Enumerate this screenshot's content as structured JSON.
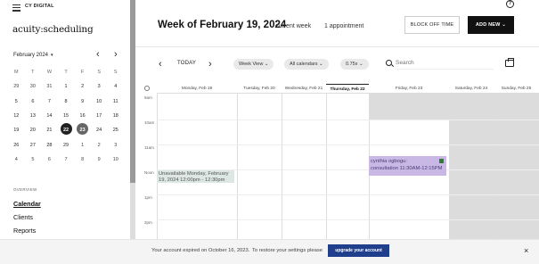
{
  "sidebar": {
    "brand": "CY DIGITAL",
    "logo": "acuity:scheduling",
    "month_label": "February 2024",
    "days_of_week": [
      "M",
      "T",
      "W",
      "T",
      "F",
      "S",
      "S"
    ],
    "weeks": [
      [
        "29",
        "30",
        "31",
        "1",
        "2",
        "3",
        "4"
      ],
      [
        "5",
        "6",
        "7",
        "8",
        "9",
        "10",
        "11"
      ],
      [
        "12",
        "13",
        "14",
        "15",
        "16",
        "17",
        "18"
      ],
      [
        "19",
        "20",
        "21",
        "22",
        "23",
        "24",
        "25"
      ],
      [
        "26",
        "27",
        "28",
        "29",
        "1",
        "2",
        "3"
      ],
      [
        "4",
        "5",
        "6",
        "7",
        "8",
        "9",
        "10"
      ]
    ],
    "overview_label": "OVERVIEW",
    "nav": {
      "calendar": "Calendar",
      "clients": "Clients",
      "reports": "Reports"
    }
  },
  "header": {
    "week_title": "Week of February 19, 2024",
    "current_week": "current week",
    "appointments": "1 appointment",
    "block_off_time": "BLOCK OFF TIME",
    "add_new": "ADD NEW",
    "help": "?"
  },
  "toolbar": {
    "today": "TODAY",
    "view": "Week View",
    "calendars": "All calendars",
    "zoom": "0.75x",
    "search_placeholder": "Search"
  },
  "grid": {
    "days": [
      "Monday, Feb 19",
      "Tuesday, Feb 20",
      "Wednesday, Feb 21",
      "Thursday, Feb 22",
      "Friday, Feb 23",
      "Saturday, Feb 24",
      "Sunday, Feb 25"
    ],
    "hours": [
      "9am",
      "10am",
      "11am",
      "Noon",
      "1pm",
      "2pm"
    ],
    "unavailable_text": "Unavailable Monday, February 19, 2024 12:00pm - 12:30pm",
    "appointment": {
      "name": "cynthia ogbogu:",
      "detail": "consultation  11:30AM-12:15PM"
    }
  },
  "banner": {
    "text": "Your account expired on October 16, 2023.",
    "text2": "To restore your settings please",
    "upgrade": "upgrade your account",
    "close": "×"
  }
}
